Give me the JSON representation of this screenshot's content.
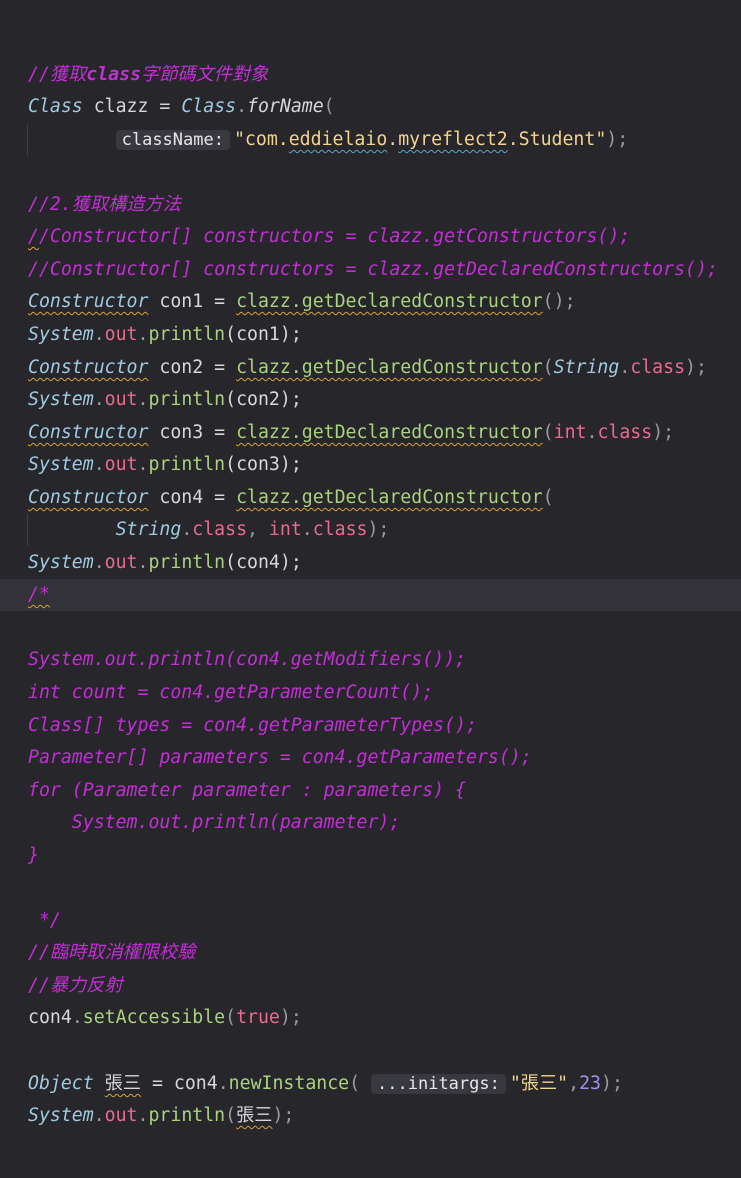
{
  "lines": [
    {
      "tokens": []
    },
    {
      "tokens": [
        {
          "t": "//獲取",
          "c": "c"
        },
        {
          "t": "class",
          "c": "cb"
        },
        {
          "t": "字節碼文件對象",
          "c": "c"
        }
      ]
    },
    {
      "tokens": [
        {
          "t": "Class",
          "c": "ty"
        },
        {
          "t": " clazz ",
          "c": "t"
        },
        {
          "t": "=",
          "c": "t"
        },
        {
          "t": " ",
          "c": "t"
        },
        {
          "t": "Class",
          "c": "ty"
        },
        {
          "t": ".",
          "c": "p"
        },
        {
          "t": "forName",
          "c": "fn"
        },
        {
          "t": "(",
          "c": "p"
        }
      ]
    },
    {
      "guide": true,
      "tokens": [
        {
          "t": "        ",
          "c": "t"
        },
        {
          "t": "className:",
          "c": "hint"
        },
        {
          "t": "\"com.",
          "c": "s"
        },
        {
          "t": "eddielaio",
          "c": "s",
          "u": "ug"
        },
        {
          "t": ".",
          "c": "s"
        },
        {
          "t": "myreflect2",
          "c": "s",
          "u": "ug"
        },
        {
          "t": ".Student\"",
          "c": "s"
        },
        {
          "t": ");",
          "c": "p"
        }
      ]
    },
    {
      "tokens": []
    },
    {
      "tokens": [
        {
          "t": "//2.獲取構造方法",
          "c": "c"
        }
      ]
    },
    {
      "tokens": [
        {
          "t": "/",
          "c": "c",
          "u": "u"
        },
        {
          "t": "/Constructor[] constructors = clazz.getConstructors();",
          "c": "c"
        }
      ]
    },
    {
      "tokens": [
        {
          "t": "//Constructor[] constructors = clazz.getDeclaredConstructors();",
          "c": "c"
        }
      ]
    },
    {
      "tokens": [
        {
          "t": "Constructor",
          "c": "ty",
          "u": "u"
        },
        {
          "t": " con1 = ",
          "c": "t"
        },
        {
          "t": "clazz.getDeclaredConstructor",
          "c": "m",
          "u": "u"
        },
        {
          "t": "();",
          "c": "p"
        }
      ]
    },
    {
      "tokens": [
        {
          "t": "System",
          "c": "st"
        },
        {
          "t": ".",
          "c": "p"
        },
        {
          "t": "out",
          "c": "f"
        },
        {
          "t": ".",
          "c": "p"
        },
        {
          "t": "println",
          "c": "m"
        },
        {
          "t": "(con1);",
          "c": "t"
        }
      ]
    },
    {
      "tokens": [
        {
          "t": "Constructor",
          "c": "ty",
          "u": "u"
        },
        {
          "t": " con2 = ",
          "c": "t"
        },
        {
          "t": "clazz.getDeclaredConstructor",
          "c": "m",
          "u": "u"
        },
        {
          "t": "(",
          "c": "p"
        },
        {
          "t": "String",
          "c": "ty"
        },
        {
          "t": ".",
          "c": "p"
        },
        {
          "t": "class",
          "c": "kw"
        },
        {
          "t": ");",
          "c": "p"
        }
      ]
    },
    {
      "tokens": [
        {
          "t": "System",
          "c": "st"
        },
        {
          "t": ".",
          "c": "p"
        },
        {
          "t": "out",
          "c": "f"
        },
        {
          "t": ".",
          "c": "p"
        },
        {
          "t": "println",
          "c": "m"
        },
        {
          "t": "(con2);",
          "c": "t"
        }
      ]
    },
    {
      "tokens": [
        {
          "t": "Constructor",
          "c": "ty",
          "u": "u"
        },
        {
          "t": " con3 = ",
          "c": "t"
        },
        {
          "t": "clazz.getDeclaredConstructor",
          "c": "m",
          "u": "u"
        },
        {
          "t": "(",
          "c": "p"
        },
        {
          "t": "int",
          "c": "kw"
        },
        {
          "t": ".",
          "c": "p"
        },
        {
          "t": "class",
          "c": "kw"
        },
        {
          "t": ");",
          "c": "p"
        }
      ]
    },
    {
      "tokens": [
        {
          "t": "System",
          "c": "st"
        },
        {
          "t": ".",
          "c": "p"
        },
        {
          "t": "out",
          "c": "f"
        },
        {
          "t": ".",
          "c": "p"
        },
        {
          "t": "println",
          "c": "m"
        },
        {
          "t": "(con3);",
          "c": "t"
        }
      ]
    },
    {
      "tokens": [
        {
          "t": "Constructor",
          "c": "ty",
          "u": "u"
        },
        {
          "t": " con4 = ",
          "c": "t"
        },
        {
          "t": "clazz.getDeclaredConstructor",
          "c": "m",
          "u": "u"
        },
        {
          "t": "(",
          "c": "p"
        }
      ]
    },
    {
      "guide": true,
      "tokens": [
        {
          "t": "        ",
          "c": "t"
        },
        {
          "t": "String",
          "c": "ty"
        },
        {
          "t": ".",
          "c": "p"
        },
        {
          "t": "class",
          "c": "kw"
        },
        {
          "t": ", ",
          "c": "p"
        },
        {
          "t": "int",
          "c": "kw"
        },
        {
          "t": ".",
          "c": "p"
        },
        {
          "t": "class",
          "c": "kw"
        },
        {
          "t": ");",
          "c": "p"
        }
      ]
    },
    {
      "tokens": [
        {
          "t": "System",
          "c": "st"
        },
        {
          "t": ".",
          "c": "p"
        },
        {
          "t": "out",
          "c": "f"
        },
        {
          "t": ".",
          "c": "p"
        },
        {
          "t": "println",
          "c": "m"
        },
        {
          "t": "(con4);",
          "c": "t"
        }
      ]
    },
    {
      "current": true,
      "tokens": [
        {
          "t": "/*",
          "c": "c",
          "u": "u"
        }
      ]
    },
    {
      "tokens": []
    },
    {
      "tokens": [
        {
          "t": "System.out.println(con4.getModifiers());",
          "c": "c"
        }
      ]
    },
    {
      "tokens": [
        {
          "t": "int count = con4.getParameterCount();",
          "c": "c"
        }
      ]
    },
    {
      "tokens": [
        {
          "t": "Class[] types = con4.getParameterTypes();",
          "c": "c"
        }
      ]
    },
    {
      "tokens": [
        {
          "t": "Parameter[] parameters = con4.getParameters();",
          "c": "c"
        }
      ]
    },
    {
      "tokens": [
        {
          "t": "for (Parameter parameter : parameters) {",
          "c": "c"
        }
      ]
    },
    {
      "tokens": [
        {
          "t": "    System.out.println(parameter);",
          "c": "c"
        }
      ]
    },
    {
      "tokens": [
        {
          "t": "}",
          "c": "c"
        }
      ]
    },
    {
      "tokens": []
    },
    {
      "tokens": [
        {
          "t": " */",
          "c": "c"
        }
      ]
    },
    {
      "tokens": [
        {
          "t": "//臨時取消權限校驗",
          "c": "c"
        }
      ]
    },
    {
      "tokens": [
        {
          "t": "//暴力反射",
          "c": "c"
        }
      ]
    },
    {
      "tokens": [
        {
          "t": "con4",
          "c": "t"
        },
        {
          "t": ".",
          "c": "p"
        },
        {
          "t": "setAccessible",
          "c": "m"
        },
        {
          "t": "(",
          "c": "p"
        },
        {
          "t": "true",
          "c": "kw"
        },
        {
          "t": ");",
          "c": "p"
        }
      ]
    },
    {
      "tokens": []
    },
    {
      "tokens": [
        {
          "t": "Object",
          "c": "ty"
        },
        {
          "t": " ",
          "c": "t"
        },
        {
          "t": "張三",
          "c": "t",
          "u": "ur"
        },
        {
          "t": " = ",
          "c": "t"
        },
        {
          "t": "con4",
          "c": "t"
        },
        {
          "t": ".",
          "c": "p"
        },
        {
          "t": "newInstance",
          "c": "m"
        },
        {
          "t": "( ",
          "c": "p"
        },
        {
          "t": "...initargs:",
          "c": "hint"
        },
        {
          "t": "\"張三\"",
          "c": "s"
        },
        {
          "t": ",",
          "c": "p"
        },
        {
          "t": "23",
          "c": "n"
        },
        {
          "t": ");",
          "c": "p"
        }
      ]
    },
    {
      "tokens": [
        {
          "t": "System",
          "c": "st"
        },
        {
          "t": ".",
          "c": "p"
        },
        {
          "t": "out",
          "c": "f"
        },
        {
          "t": ".",
          "c": "p"
        },
        {
          "t": "println",
          "c": "m"
        },
        {
          "t": "(",
          "c": "p"
        },
        {
          "t": "張三",
          "c": "t",
          "u": "ur"
        },
        {
          "t": ");",
          "c": "p"
        }
      ]
    }
  ]
}
